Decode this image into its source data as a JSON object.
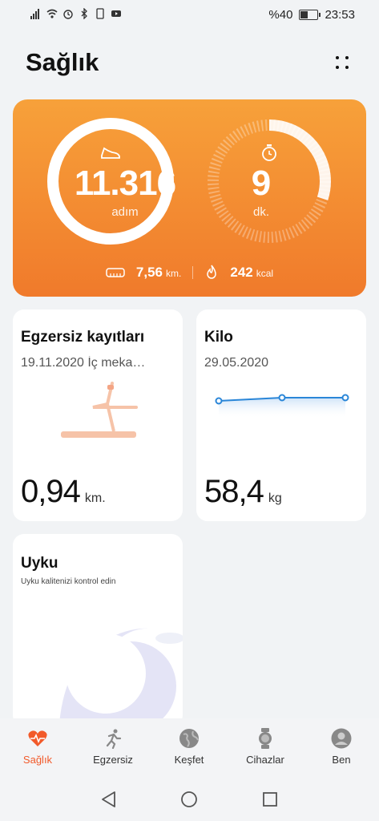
{
  "status_bar": {
    "battery_text": "%40",
    "time": "23:53"
  },
  "header": {
    "title": "Sağlık"
  },
  "summary": {
    "steps_value": "11.316",
    "steps_unit": "adım",
    "minutes_value": "9",
    "minutes_unit": "dk.",
    "distance_value": "7,56",
    "distance_unit": "km.",
    "calories_value": "242",
    "calories_unit": "kcal",
    "steps_progress": 1.0,
    "minutes_progress": 0.3
  },
  "cards": {
    "exercise": {
      "title": "Egzersiz kayıtları",
      "subtitle": "19.11.2020 İç meka…",
      "value": "0,94",
      "unit": "km."
    },
    "weight": {
      "title": "Kilo",
      "subtitle": "29.05.2020",
      "value": "58,4",
      "unit": "kg",
      "trend": [
        58.2,
        58.4,
        58.4
      ]
    },
    "sleep": {
      "title": "Uyku",
      "subtitle": "Uyku kalitenizi kontrol edin"
    }
  },
  "nav": {
    "items": [
      {
        "label": "Sağlık",
        "icon": "heart-pulse-icon",
        "active": true
      },
      {
        "label": "Egzersiz",
        "icon": "running-icon",
        "active": false
      },
      {
        "label": "Keşfet",
        "icon": "globe-icon",
        "active": false
      },
      {
        "label": "Cihazlar",
        "icon": "watch-icon",
        "active": false
      },
      {
        "label": "Ben",
        "icon": "person-icon",
        "active": false
      }
    ]
  },
  "colors": {
    "accent": "#f25a2a",
    "card_orange": "#f58b33",
    "chart_blue": "#2a86d8"
  }
}
